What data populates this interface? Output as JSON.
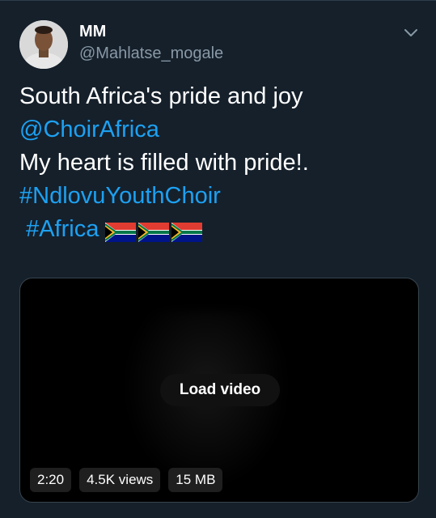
{
  "tweet": {
    "display_name": "MM",
    "handle": "@Mahlatse_mogale",
    "lines": {
      "l1": "South Africa's pride and joy",
      "mention": "@ChoirAfrica",
      "l3": "My heart is filled with pride!.",
      "hashtag1": "#NdlovuYouthChoir",
      "hashtag2": "#Africa"
    },
    "emoji": [
      "flag-south-africa",
      "flag-south-africa",
      "flag-south-africa"
    ]
  },
  "media": {
    "load_label": "Load video",
    "duration": "2:20",
    "views": "4.5K views",
    "size": "15 MB"
  },
  "colors": {
    "background": "#15202b",
    "link": "#1da1f2",
    "secondary_text": "#8899a6"
  }
}
